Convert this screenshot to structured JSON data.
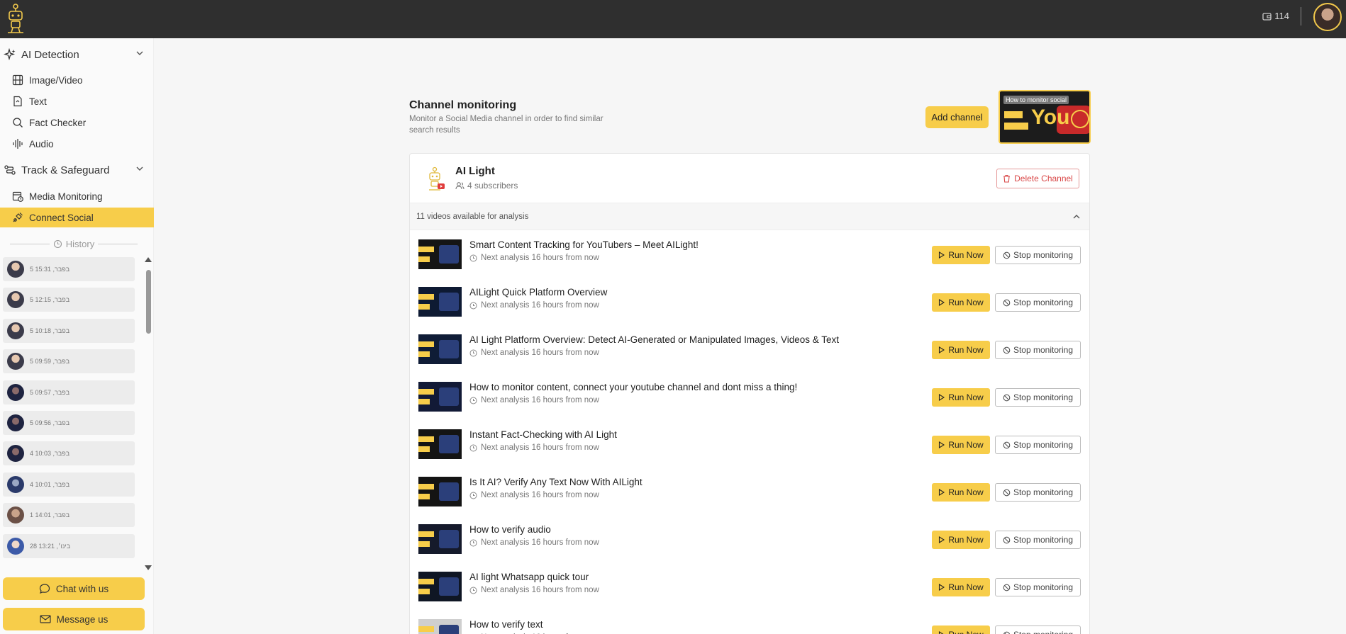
{
  "header": {
    "credits": "114",
    "icons": [
      "logo-robot-icon",
      "wallet-icon",
      "avatar"
    ]
  },
  "sidebar": {
    "ai_detection": {
      "title": "AI Detection",
      "items": [
        {
          "label": "Image/Video",
          "icon": "film-icon"
        },
        {
          "label": "Text",
          "icon": "document-icon"
        },
        {
          "label": "Fact Checker",
          "icon": "magnifier-icon"
        },
        {
          "label": "Audio",
          "icon": "waveform-icon"
        }
      ]
    },
    "track": {
      "title": "Track & Safeguard",
      "items": [
        {
          "label": "Media Monitoring",
          "icon": "calendar-clock-icon"
        },
        {
          "label": "Connect Social",
          "icon": "plug-icon",
          "active": true
        }
      ]
    },
    "history_label": "History",
    "history": [
      {
        "time": "5 15:31 ,בפבר"
      },
      {
        "time": "5 12:15 ,בפבר"
      },
      {
        "time": "5 10:18 ,בפבר"
      },
      {
        "time": "5 09:59 ,בפבר"
      },
      {
        "time": "5 09:57 ,בפבר"
      },
      {
        "time": "5 09:56 ,בפבר"
      },
      {
        "time": "4 10:03 ,בפבר"
      },
      {
        "time": "4 10:01 ,בפבר"
      },
      {
        "time": "1 14:01 ,בפבר"
      },
      {
        "time": "28 13:21 ,בינו׳"
      }
    ],
    "chat_label": "Chat with us",
    "message_label": "Message us"
  },
  "main": {
    "title": "Channel monitoring",
    "subtitle": "Monitor a Social Media channel in order to find similar search results",
    "add_channel": "Add channel",
    "video_caption": "How to monitor social",
    "channel": {
      "name": "AI Light",
      "subscribers": "4 subscribers",
      "delete_label": "Delete Channel",
      "videos_available": "11 videos available for analysis"
    },
    "run_label": "Run Now",
    "stop_label": "Stop monitoring",
    "next_analysis": "Next analysis 16 hours from now",
    "videos": [
      {
        "title": "Smart Content Tracking for YouTubers – Meet AILight!"
      },
      {
        "title": "AILight Quick Platform Overview"
      },
      {
        "title": "AI Light Platform Overview: Detect AI-Generated or Manipulated Images, Videos & Text"
      },
      {
        "title": "How to monitor content, connect your youtube channel and dont miss a thing!"
      },
      {
        "title": "Instant Fact-Checking with AI Light"
      },
      {
        "title": "Is It AI? Verify Any Text Now With AILight"
      },
      {
        "title": "How to verify audio"
      },
      {
        "title": "AI light Whatsapp quick tour"
      },
      {
        "title": "How to verify text"
      }
    ]
  },
  "colors": {
    "accent": "#f7cd4a",
    "topbar": "#2f2f2f",
    "danger": "#d94848"
  }
}
